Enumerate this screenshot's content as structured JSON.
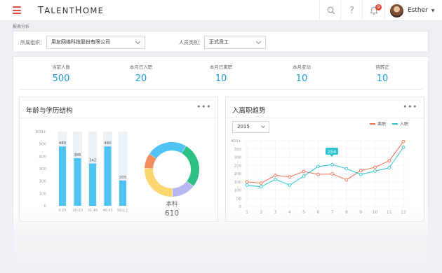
{
  "header": {
    "logo_prefix": "T",
    "logo_mid": "ALENT",
    "logo_h": "H",
    "logo_suffix": "OME",
    "notification_count": "9",
    "user_name": "Esther",
    "icons": [
      "menu-icon",
      "search-icon",
      "help-icon",
      "bell-icon",
      "chevron-down-icon"
    ]
  },
  "breadcrumb": "报表分析",
  "filters": {
    "org_label": "所属组织：",
    "org_value": "用友网络科技股份有限公司",
    "type_label": "人员类别：",
    "type_value": "正式员工"
  },
  "stats": [
    {
      "label": "当前人数",
      "value": "500"
    },
    {
      "label": "本月已入职",
      "value": "20"
    },
    {
      "label": "本月已离职",
      "value": "10"
    },
    {
      "label": "本月变动",
      "value": "10"
    },
    {
      "label": "待转正",
      "value": "10"
    }
  ],
  "colors": {
    "accent": "#1e9bd7",
    "bar": "#4fc3f2",
    "line_leave": "#f06e50",
    "line_join": "#2ec5d2",
    "brand_red": "#e14b3b"
  },
  "age_card": {
    "title": "年龄与学历结构",
    "more": "•••",
    "donut_label": "本科",
    "donut_value": "610"
  },
  "trend_card": {
    "title": "入离职趋势",
    "more": "•••",
    "year": "2015",
    "legend_leave": "离职",
    "legend_join": "入职",
    "tooltip": "254"
  },
  "chart_data": [
    {
      "type": "bar",
      "categories": [
        "0-25",
        "26-30",
        "31-45",
        "46-55",
        "56以上"
      ],
      "values": [
        480,
        385,
        342,
        480,
        205
      ],
      "ylim": [
        0,
        600
      ],
      "yticks": [
        "0",
        "100",
        "200",
        "300",
        "400",
        "500",
        "600+"
      ]
    },
    {
      "type": "pie",
      "donut": true,
      "slices": [
        {
          "value": 27,
          "color": "#2dbf86"
        },
        {
          "value": 14,
          "color": "#b6b6f0"
        },
        {
          "value": 26,
          "color": "#fcd66f"
        },
        {
          "value": 9,
          "color": "#f48c5d"
        },
        {
          "value": 24,
          "color": "#4fc3f2"
        }
      ]
    },
    {
      "type": "line",
      "x": [
        "1",
        "2",
        "3",
        "4",
        "5",
        "6",
        "7",
        "8",
        "9",
        "10",
        "11",
        "12"
      ],
      "ylim": [
        0,
        400
      ],
      "yticks": [
        "0",
        "50",
        "100",
        "150",
        "200",
        "250",
        "300",
        "350",
        "400+"
      ],
      "series": [
        {
          "name": "离职",
          "color": "#f06e50",
          "values": [
            150,
            142,
            190,
            180,
            213,
            195,
            198,
            162,
            218,
            238,
            278,
            395
          ]
        },
        {
          "name": "入职",
          "color": "#2ec5d2",
          "values": [
            130,
            120,
            165,
            130,
            185,
            243,
            254,
            230,
            195,
            215,
            235,
            360
          ]
        }
      ]
    }
  ]
}
